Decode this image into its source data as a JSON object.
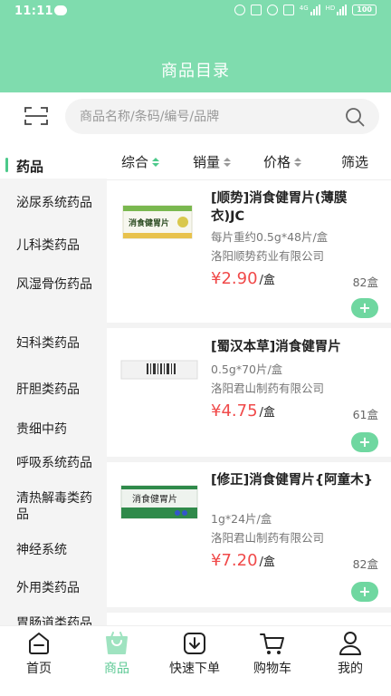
{
  "status_bar": {
    "time": "11:11",
    "battery": "100"
  },
  "header": {
    "title": "商品目录"
  },
  "search": {
    "placeholder": "商品名称/条码/编号/品牌"
  },
  "categories": [
    {
      "label": "药品",
      "active": true
    },
    {
      "label": "泌尿系统药品"
    },
    {
      "label": "儿科类药品"
    },
    {
      "label": "风湿骨伤药品"
    },
    {
      "label": "妇科类药品"
    },
    {
      "label": "肝胆类药品"
    },
    {
      "label": "贵细中药"
    },
    {
      "label": "呼吸系统药品"
    },
    {
      "label": "清热解毒类药品"
    },
    {
      "label": "神经系统"
    },
    {
      "label": "外用类药品"
    },
    {
      "label": "胃肠道类药品"
    }
  ],
  "sort": {
    "comprehensive": "综合",
    "sales": "销量",
    "price": "价格",
    "filter": "筛选"
  },
  "products": [
    {
      "name": "[顺势]消食健胃片(薄膜衣)JC",
      "spec": "每片重约0.5g*48片/盒",
      "maker": "洛阳顺势药业有限公司",
      "price": "¥2.90",
      "unit": "/盒",
      "stock": "82盒",
      "add": "+",
      "box_text": "消食健胃片"
    },
    {
      "name": "[蜀汉本草]消食健胃片",
      "spec": "0.5g*70片/盒",
      "maker": "洛阳君山制药有限公司",
      "price": "¥4.75",
      "unit": "/盒",
      "stock": "61盒",
      "add": "+"
    },
    {
      "name": "[修正]消食健胃片{阿童木}",
      "spec": "1g*24片/盒",
      "maker": "洛阳君山制药有限公司",
      "price": "¥7.20",
      "unit": "/盒",
      "stock": "82盒",
      "add": "+",
      "box_text": "消食健胃片"
    }
  ],
  "tabbar": [
    {
      "label": "首页",
      "icon": "home-icon"
    },
    {
      "label": "商品",
      "icon": "bag-icon",
      "active": true
    },
    {
      "label": "快速下单",
      "icon": "download-icon"
    },
    {
      "label": "购物车",
      "icon": "cart-icon"
    },
    {
      "label": "我的",
      "icon": "user-icon"
    }
  ],
  "colors": {
    "header": "#7fdcae",
    "accent": "#5cc994",
    "price": "#f04a4a"
  }
}
